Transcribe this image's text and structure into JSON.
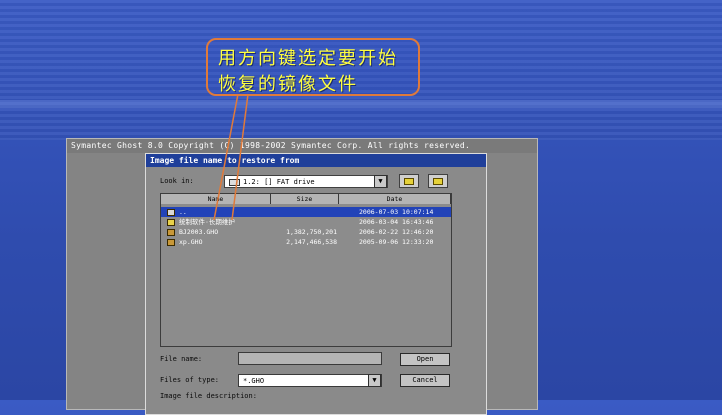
{
  "background": {
    "accent": "#3554bb"
  },
  "ghost_window": {
    "title": "Symantec Ghost 8.0    Copyright (C) 1998-2002 Symantec Corp. All rights reserved."
  },
  "dialog": {
    "title": "Image file name to restore from",
    "look_in_label": "Look in:",
    "look_in_value": "1.2: [] FAT drive",
    "dropdown_glyph": "▼",
    "columns": [
      "Name",
      "Size",
      "Date"
    ],
    "rows": [
      {
        "name": "..",
        "size": "",
        "date": "2006-07-03 10:07:14",
        "icon": "parent-folder-icon",
        "selected": true
      },
      {
        "name": "统制软件·长期维护",
        "size": "",
        "date": "2006-03-04 16:43:46",
        "icon": "folder-icon",
        "selected": false
      },
      {
        "name": "BJ2003.GHO",
        "size": "1,382,750,201",
        "date": "2006-02-22 12:46:20",
        "icon": "ghost-file-icon",
        "selected": false
      },
      {
        "name": "xp.GHO",
        "size": "2,147,466,538",
        "date": "2005-09-06 12:33:20",
        "icon": "ghost-file-icon",
        "selected": false
      }
    ],
    "file_name_label": "File name:",
    "file_name_value": "",
    "files_of_type_label": "Files of type:",
    "files_of_type_value": "*.GHO",
    "description_label": "Image file description:",
    "open_button": "Open",
    "cancel_button": "Cancel"
  },
  "annotation": {
    "line1": "用方向键选定要开始",
    "line2": "恢复的镜像文件",
    "border_color": "#e07a3a",
    "text_color": "#ffff40"
  }
}
